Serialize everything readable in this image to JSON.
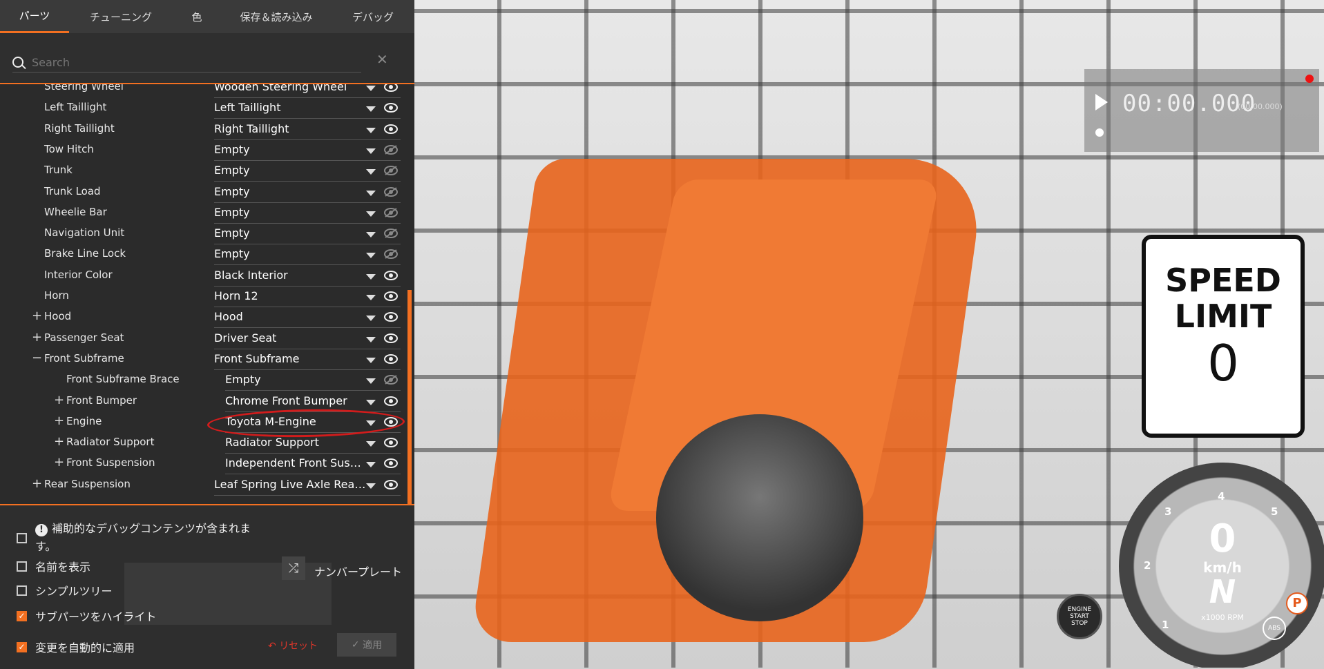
{
  "tabs": [
    {
      "label": "パーツ"
    },
    {
      "label": "チューニング"
    },
    {
      "label": "色"
    },
    {
      "label": "保存＆読み込み"
    },
    {
      "label": "デバッグ"
    }
  ],
  "search": {
    "placeholder": "Search",
    "clear_icon": "close-icon"
  },
  "parts": [
    {
      "name": "Steering Wheel",
      "value": "Wooden Steering Wheel",
      "visible": true
    },
    {
      "name": "Left Taillight",
      "value": "Left Taillight",
      "visible": true
    },
    {
      "name": "Right Taillight",
      "value": "Right Taillight",
      "visible": true
    },
    {
      "name": "Tow Hitch",
      "value": "Empty",
      "visible": false
    },
    {
      "name": "Trunk",
      "value": "Empty",
      "visible": false
    },
    {
      "name": "Trunk Load",
      "value": "Empty",
      "visible": false
    },
    {
      "name": "Wheelie Bar",
      "value": "Empty",
      "visible": false
    },
    {
      "name": "Navigation Unit",
      "value": "Empty",
      "visible": false
    },
    {
      "name": "Brake Line Lock",
      "value": "Empty",
      "visible": false
    },
    {
      "name": "Interior Color",
      "value": "Black Interior",
      "visible": true
    },
    {
      "name": "Horn",
      "value": "Horn 12",
      "visible": true
    },
    {
      "name": "Hood",
      "value": "Hood",
      "visible": true,
      "toggle": "+"
    },
    {
      "name": "Passenger Seat",
      "value": "Driver Seat",
      "visible": true,
      "toggle": "+"
    },
    {
      "name": "Front Subframe",
      "value": "Front Subframe",
      "visible": true,
      "toggle": "−"
    },
    {
      "name": "Front Subframe Brace",
      "value": "Empty",
      "visible": false
    },
    {
      "name": "Front Bumper",
      "value": "Chrome Front Bumper",
      "visible": true,
      "toggle": "+"
    },
    {
      "name": "Engine",
      "value": "Toyota M-Engine",
      "visible": true,
      "toggle": "+"
    },
    {
      "name": "Radiator Support",
      "value": "Radiator Support",
      "visible": true,
      "toggle": "+"
    },
    {
      "name": "Front Suspension",
      "value": "Independent Front Susp...",
      "visible": true,
      "toggle": "+"
    },
    {
      "name": "Rear Suspension",
      "value": "Leaf Spring Live Axle Rear...",
      "visible": true,
      "toggle": "+"
    }
  ],
  "options": {
    "debug_content_line1": "補助的なデバッグコンテンツが含まれま",
    "debug_content_line2": "す。",
    "show_names": "名前を表示",
    "simple_tree": "シンプルツリー",
    "highlight_subparts": "サブパーツをハイライト",
    "auto_apply": "変更を自動的に適用",
    "license_plate": "ナンバープレート",
    "reset": "リセット",
    "apply": "適用"
  },
  "checks": {
    "debug": false,
    "names": false,
    "simple": false,
    "highlight": true,
    "auto": true
  },
  "replay": {
    "time": "00:00.000",
    "time_small": "(00:00.000)"
  },
  "speed_sign": {
    "line1": "SPEED",
    "line2": "LIMIT",
    "value": "0"
  },
  "gauge": {
    "speed": "0",
    "unit": "km/h",
    "gear": "N",
    "rpm_label": "x1000 RPM",
    "marks": [
      "1",
      "2",
      "3",
      "4",
      "5"
    ]
  },
  "engine_button": {
    "l1": "ENGINE",
    "l2": "START",
    "l3": "STOP"
  },
  "parking": "P",
  "abs": "ABS",
  "colors": {
    "accent": "#f37021",
    "panel": "#2b2b2b",
    "highlight_ring": "#d21c1c"
  }
}
